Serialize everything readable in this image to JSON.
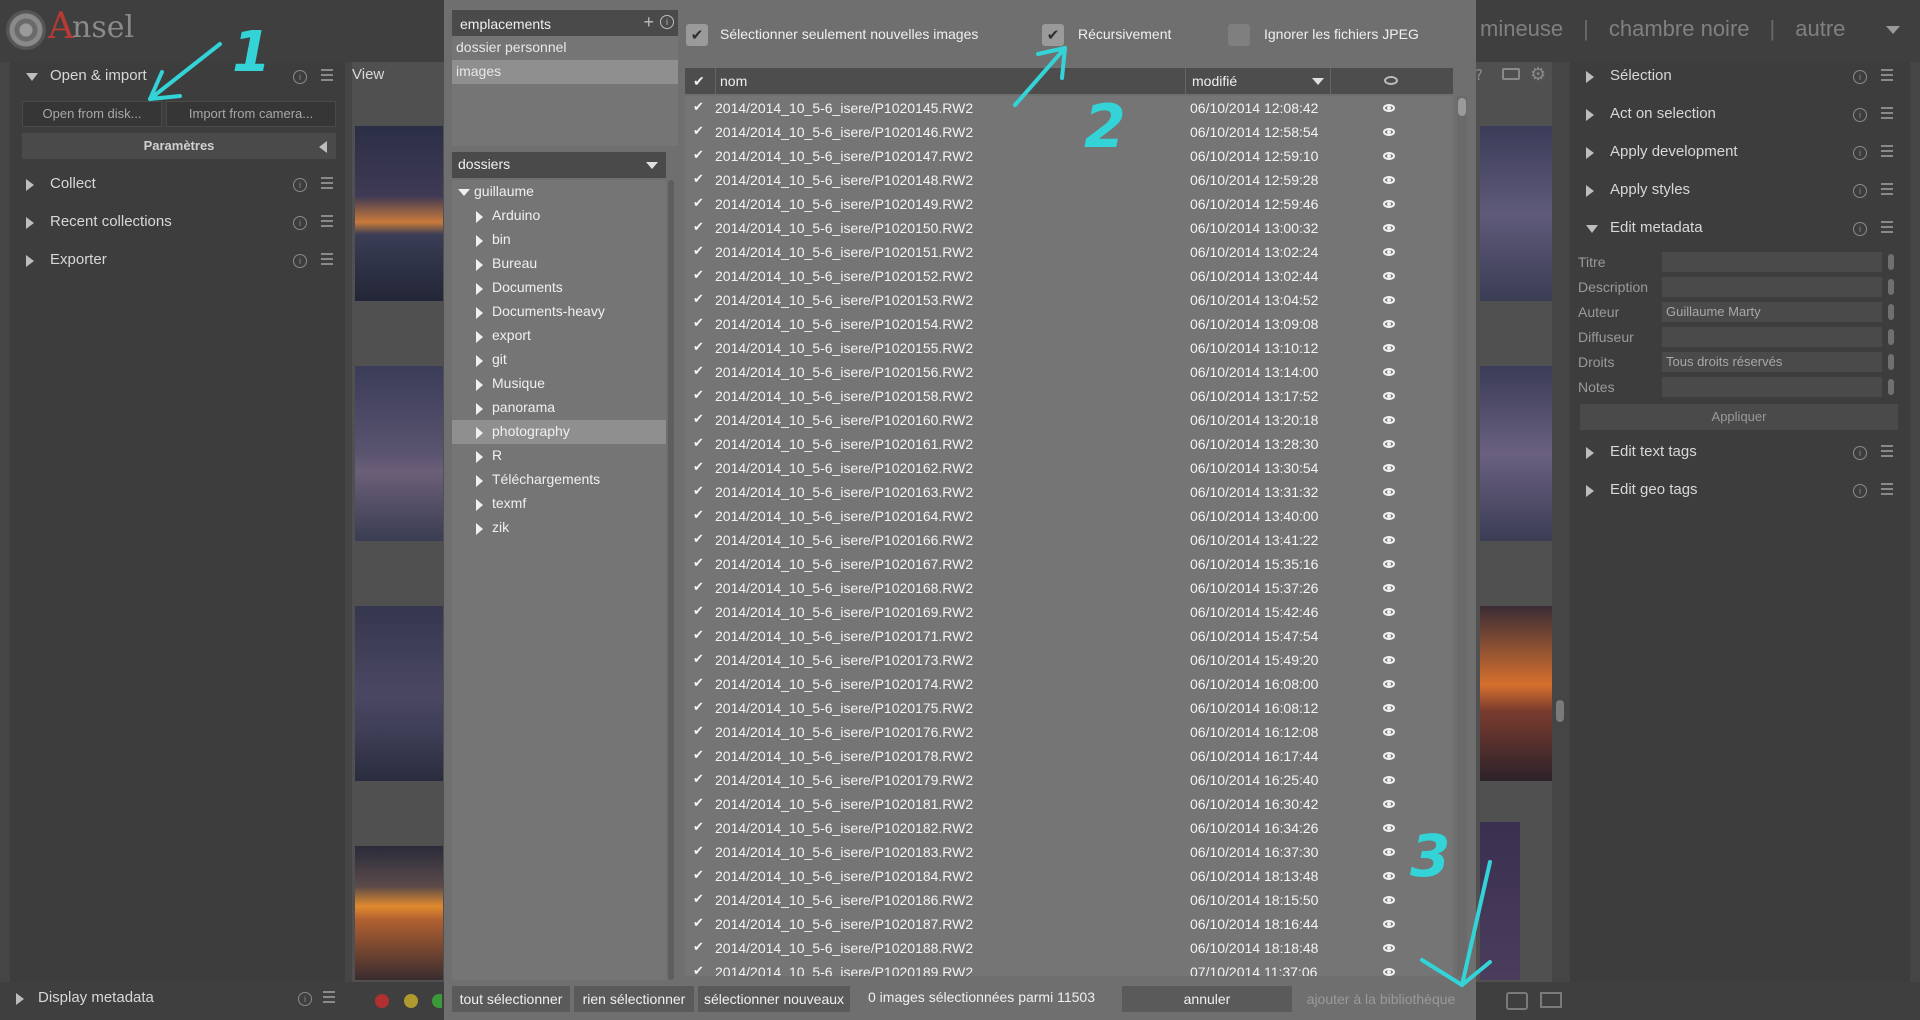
{
  "app": {
    "logo_initial": "A",
    "logo_rest": "nsel"
  },
  "views": {
    "items": [
      "mineuse",
      "chambre noire",
      "autre"
    ],
    "separator": "|"
  },
  "left_panel": {
    "modules": [
      {
        "label": "Open & import",
        "expanded": true
      },
      {
        "label": "Collect",
        "expanded": false
      },
      {
        "label": "Recent collections",
        "expanded": false
      },
      {
        "label": "Exporter",
        "expanded": false
      }
    ],
    "open_from_disk": "Open from disk...",
    "import_from_camera": "Import from camera...",
    "params_label": "Paramètres",
    "display_metadata": "Display metadata"
  },
  "center": {
    "view_label": "View"
  },
  "right_panel": {
    "modules": [
      {
        "label": "Sélection",
        "expanded": false
      },
      {
        "label": "Act on selection",
        "expanded": false
      },
      {
        "label": "Apply development",
        "expanded": false
      },
      {
        "label": "Apply styles",
        "expanded": false
      },
      {
        "label": "Edit metadata",
        "expanded": true
      }
    ],
    "metadata": [
      {
        "key": "Titre",
        "value": ""
      },
      {
        "key": "Description",
        "value": ""
      },
      {
        "key": "Auteur",
        "value": "Guillaume Marty"
      },
      {
        "key": "Diffuseur",
        "value": ""
      },
      {
        "key": "Droits",
        "value": "Tous droits réservés"
      },
      {
        "key": "Notes",
        "value": ""
      }
    ],
    "apply_label": "Appliquer",
    "modules_after": [
      {
        "label": "Edit text tags"
      },
      {
        "label": "Edit geo tags"
      }
    ]
  },
  "dialog": {
    "places_title": "emplacements",
    "places": [
      "dossier personnel",
      "images"
    ],
    "places_selected": 1,
    "folders_title": "dossiers",
    "folder_root": "guillaume",
    "folders": [
      "Arduino",
      "bin",
      "Bureau",
      "Documents",
      "Documents-heavy",
      "export",
      "git",
      "Musique",
      "panorama",
      "photography",
      "R",
      "Téléchargements",
      "texmf",
      "zik"
    ],
    "folder_selected": 9,
    "options": {
      "only_new": {
        "label": "Sélectionner seulement nouvelles images",
        "checked": true
      },
      "recursive": {
        "label": "Récursivement",
        "checked": true
      },
      "ignore_jpeg": {
        "label": "Ignorer les fichiers JPEG",
        "checked": false
      }
    },
    "columns": {
      "check": "✔",
      "name": "nom",
      "modified": "modifié",
      "thumb": "eye-icon"
    },
    "rows": [
      {
        "check": "✔",
        "name": "2014/2014_10_5-6_isere/P1020145.RW2",
        "date": "06/10/2014 12:08:42"
      },
      {
        "check": "✔",
        "name": "2014/2014_10_5-6_isere/P1020146.RW2",
        "date": "06/10/2014 12:58:54"
      },
      {
        "check": "✔",
        "name": "2014/2014_10_5-6_isere/P1020147.RW2",
        "date": "06/10/2014 12:59:10"
      },
      {
        "check": "✔",
        "name": "2014/2014_10_5-6_isere/P1020148.RW2",
        "date": "06/10/2014 12:59:28"
      },
      {
        "check": "✔",
        "name": "2014/2014_10_5-6_isere/P1020149.RW2",
        "date": "06/10/2014 12:59:46"
      },
      {
        "check": "✔",
        "name": "2014/2014_10_5-6_isere/P1020150.RW2",
        "date": "06/10/2014 13:00:32"
      },
      {
        "check": "✔",
        "name": "2014/2014_10_5-6_isere/P1020151.RW2",
        "date": "06/10/2014 13:02:24"
      },
      {
        "check": "✔",
        "name": "2014/2014_10_5-6_isere/P1020152.RW2",
        "date": "06/10/2014 13:02:44"
      },
      {
        "check": "✔",
        "name": "2014/2014_10_5-6_isere/P1020153.RW2",
        "date": "06/10/2014 13:04:52"
      },
      {
        "check": "✔",
        "name": "2014/2014_10_5-6_isere/P1020154.RW2",
        "date": "06/10/2014 13:09:08"
      },
      {
        "check": "✔",
        "name": "2014/2014_10_5-6_isere/P1020155.RW2",
        "date": "06/10/2014 13:10:12"
      },
      {
        "check": "✔",
        "name": "2014/2014_10_5-6_isere/P1020156.RW2",
        "date": "06/10/2014 13:14:00"
      },
      {
        "check": "✔",
        "name": "2014/2014_10_5-6_isere/P1020158.RW2",
        "date": "06/10/2014 13:17:52"
      },
      {
        "check": "✔",
        "name": "2014/2014_10_5-6_isere/P1020160.RW2",
        "date": "06/10/2014 13:20:18"
      },
      {
        "check": "✔",
        "name": "2014/2014_10_5-6_isere/P1020161.RW2",
        "date": "06/10/2014 13:28:30"
      },
      {
        "check": "✔",
        "name": "2014/2014_10_5-6_isere/P1020162.RW2",
        "date": "06/10/2014 13:30:54"
      },
      {
        "check": "✔",
        "name": "2014/2014_10_5-6_isere/P1020163.RW2",
        "date": "06/10/2014 13:31:32"
      },
      {
        "check": "✔",
        "name": "2014/2014_10_5-6_isere/P1020164.RW2",
        "date": "06/10/2014 13:40:00"
      },
      {
        "check": "✔",
        "name": "2014/2014_10_5-6_isere/P1020166.RW2",
        "date": "06/10/2014 13:41:22"
      },
      {
        "check": "✔",
        "name": "2014/2014_10_5-6_isere/P1020167.RW2",
        "date": "06/10/2014 15:35:16"
      },
      {
        "check": "✔",
        "name": "2014/2014_10_5-6_isere/P1020168.RW2",
        "date": "06/10/2014 15:37:26"
      },
      {
        "check": "✔",
        "name": "2014/2014_10_5-6_isere/P1020169.RW2",
        "date": "06/10/2014 15:42:46"
      },
      {
        "check": "✔",
        "name": "2014/2014_10_5-6_isere/P1020171.RW2",
        "date": "06/10/2014 15:47:54"
      },
      {
        "check": "✔",
        "name": "2014/2014_10_5-6_isere/P1020173.RW2",
        "date": "06/10/2014 15:49:20"
      },
      {
        "check": "✔",
        "name": "2014/2014_10_5-6_isere/P1020174.RW2",
        "date": "06/10/2014 16:08:00"
      },
      {
        "check": "✔",
        "name": "2014/2014_10_5-6_isere/P1020175.RW2",
        "date": "06/10/2014 16:08:12"
      },
      {
        "check": "✔",
        "name": "2014/2014_10_5-6_isere/P1020176.RW2",
        "date": "06/10/2014 16:12:08"
      },
      {
        "check": "✔",
        "name": "2014/2014_10_5-6_isere/P1020178.RW2",
        "date": "06/10/2014 16:17:44"
      },
      {
        "check": "✔",
        "name": "2014/2014_10_5-6_isere/P1020179.RW2",
        "date": "06/10/2014 16:25:40"
      },
      {
        "check": "✔",
        "name": "2014/2014_10_5-6_isere/P1020181.RW2",
        "date": "06/10/2014 16:30:42"
      },
      {
        "check": "✔",
        "name": "2014/2014_10_5-6_isere/P1020182.RW2",
        "date": "06/10/2014 16:34:26"
      },
      {
        "check": "✔",
        "name": "2014/2014_10_5-6_isere/P1020183.RW2",
        "date": "06/10/2014 16:37:30"
      },
      {
        "check": "✔",
        "name": "2014/2014_10_5-6_isere/P1020184.RW2",
        "date": "06/10/2014 18:13:48"
      },
      {
        "check": "✔",
        "name": "2014/2014_10_5-6_isere/P1020186.RW2",
        "date": "06/10/2014 18:15:50"
      },
      {
        "check": "✔",
        "name": "2014/2014_10_5-6_isere/P1020187.RW2",
        "date": "06/10/2014 18:16:44"
      },
      {
        "check": "✔",
        "name": "2014/2014_10_5-6_isere/P1020188.RW2",
        "date": "06/10/2014 18:18:48"
      },
      {
        "check": "✔",
        "name": "2014/2014_10_5-6_isere/P1020189.RW2",
        "date": "07/10/2014 11:37:06"
      }
    ],
    "buttons": {
      "select_all": "tout sélectionner",
      "select_none": "rien sélectionner",
      "select_new": "sélectionner nouveaux",
      "cancel": "annuler",
      "add": "ajouter à la bibliothèque"
    },
    "status": "0 images sélectionnées parmi 11503"
  },
  "annotations": [
    "1",
    "2",
    "3"
  ],
  "colors": {
    "annotation": "#33d3d7",
    "accent_logo": "#b83a34"
  }
}
